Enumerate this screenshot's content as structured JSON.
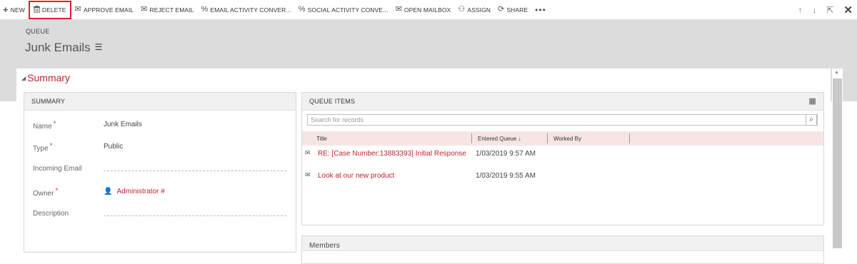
{
  "toolbar": {
    "items": [
      {
        "label": "NEW",
        "icon": "plus-icon"
      },
      {
        "label": "DELETE",
        "icon": "trash-icon"
      },
      {
        "label": "APPROVE EMAIL",
        "icon": "approve-email-icon"
      },
      {
        "label": "REJECT EMAIL",
        "icon": "reject-email-icon"
      },
      {
        "label": "EMAIL ACTIVITY CONVER...",
        "icon": "convert-icon"
      },
      {
        "label": "SOCIAL ACTIVITY CONVE...",
        "icon": "convert-icon"
      },
      {
        "label": "OPEN MAILBOX",
        "icon": "mailbox-icon"
      },
      {
        "label": "ASSIGN",
        "icon": "assign-icon"
      },
      {
        "label": "SHARE",
        "icon": "share-icon"
      }
    ],
    "more_label": "•••",
    "highlighted_item": "DELETE",
    "highlight_color": "#e0202d"
  },
  "nav_tools": [
    "arrow-up-icon",
    "arrow-down-icon",
    "pop-out-icon",
    "close-icon"
  ],
  "header": {
    "entity_type": "QUEUE",
    "record_name": "Junk Emails"
  },
  "section": {
    "title": "Summary"
  },
  "summary": {
    "heading": "SUMMARY",
    "fields": [
      {
        "label": "Name",
        "required": true,
        "value": "Junk Emails"
      },
      {
        "label": "Type",
        "required": true,
        "value": "Public"
      },
      {
        "label": "Incoming Email",
        "required": false,
        "value": ""
      },
      {
        "label": "Owner",
        "required": true,
        "value": "Administrator #"
      },
      {
        "label": "Description",
        "required": false,
        "value": ""
      }
    ]
  },
  "queue_items": {
    "heading": "QUEUE ITEMS",
    "search_placeholder": "Search for records",
    "columns": [
      "Title",
      "Entered Queue ↓",
      "Worked By"
    ],
    "rows": [
      {
        "title": "RE: [Case Number:13883393] Initial Response",
        "entered": "1/03/2019 9:57 AM",
        "worked_by": ""
      },
      {
        "title": "Look at our new product",
        "entered": "1/03/2019 9:55 AM",
        "worked_by": ""
      }
    ]
  },
  "members": {
    "heading": "Members"
  },
  "colors": {
    "accent": "#c0242d",
    "header_bg": "#dcdcdc",
    "grid_header_bg": "#f7e5e5"
  }
}
